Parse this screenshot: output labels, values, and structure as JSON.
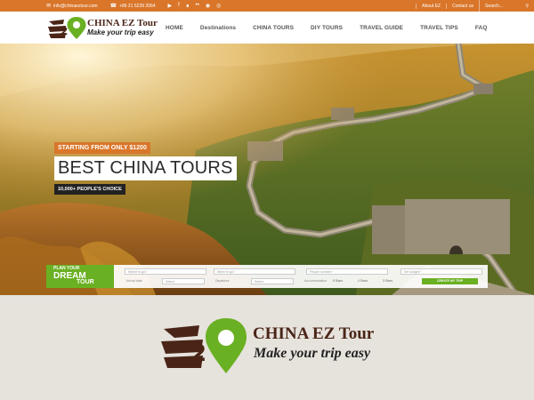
{
  "topbar": {
    "email": "info@chinaeztour.com",
    "phone": "+86 21 5239 2064",
    "social_icons": [
      "youtube-icon",
      "facebook-icon",
      "rss-icon",
      "flickr-icon",
      "wechat-icon",
      "weibo-icon"
    ],
    "about_label": "About EZ",
    "contact_label": "Contact us",
    "search_placeholder": "Search..."
  },
  "brand": {
    "name": "CHINA EZ Tour",
    "tagline": "Make your trip easy",
    "colors": {
      "brown": "#4a2517",
      "green": "#6ab023",
      "orange": "#d9762a"
    }
  },
  "nav": {
    "items": [
      "HOME",
      "Destinations",
      "CHINA TOURS",
      "DIY TOURS",
      "TRAVEL GUIDE",
      "TRAVEL TIPS",
      "FAQ"
    ]
  },
  "hero": {
    "price_badge": "STARTING FROM ONLY $1200",
    "title": "BEST CHINA TOURS",
    "people_badge": "10,000+ PEOPLE'S CHOICE"
  },
  "planner": {
    "logo_line1": "PLAN YOUR",
    "logo_line2": "DREAM",
    "logo_line3": "TOUR",
    "where_go": "Where to go?",
    "when_go": "When to go?",
    "people_label": "People number?",
    "budget_label": "Set budget?",
    "arrival_label": "Arrival date",
    "arrival_value": "Select",
    "departure_label": "Departure",
    "departure_value": "Select",
    "accommodation_label": "Accommodation",
    "star5": "5 Stars",
    "star4": "4 Stars",
    "star3": "3 Stars",
    "submit_label": "CREATE MY TRIP"
  }
}
